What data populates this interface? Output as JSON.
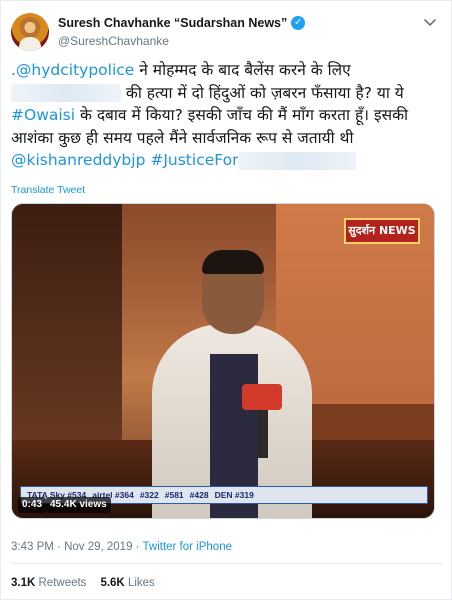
{
  "author": {
    "display_name": "Suresh Chavhanke “Sudarshan News”",
    "handle": "@SureshChavhanke",
    "verified_mark": "✓"
  },
  "menu_icon": "chevron-down-icon",
  "tweet": {
    "seg_1_link": ".@hydcitypolice",
    "seg_2": " ने मोहम्मद के बाद बैलेंस करने के लिए ",
    "seg_3": " की हत्या में दो हिंदुओं को ज़बरन फँसाया है? या ये ",
    "seg_4_link": "#Owaisi",
    "seg_5": " के दबाव में किया? इसकी जाँच की मैं माँग करता हूँ। इसकी आशंका कुछ ही समय पहले मैंने सार्वजनिक रूप से जतायी थी ",
    "seg_6_link": "@kishanreddybjp",
    "seg_7_link": " #JusticeFor"
  },
  "translate_label": "Translate Tweet",
  "video": {
    "channel_logo_text": "सुदर्शन NEWS",
    "duration": "0:43",
    "views": "45.4K views",
    "ticker_items": [
      "TATA Sky #534",
      "airtel #364",
      "#322",
      "#581",
      "#428",
      "DEN #319"
    ]
  },
  "meta": {
    "time": "3:43 PM",
    "separator": " · ",
    "date": "Nov 29, 2019",
    "source": "Twitter for iPhone"
  },
  "stats": {
    "retweets_count": "3.1K",
    "retweets_label": "Retweets",
    "likes_count": "5.6K",
    "likes_label": "Likes"
  },
  "colors": {
    "link": "#1b95e0",
    "verified": "#1da1f2",
    "muted": "#657786"
  }
}
